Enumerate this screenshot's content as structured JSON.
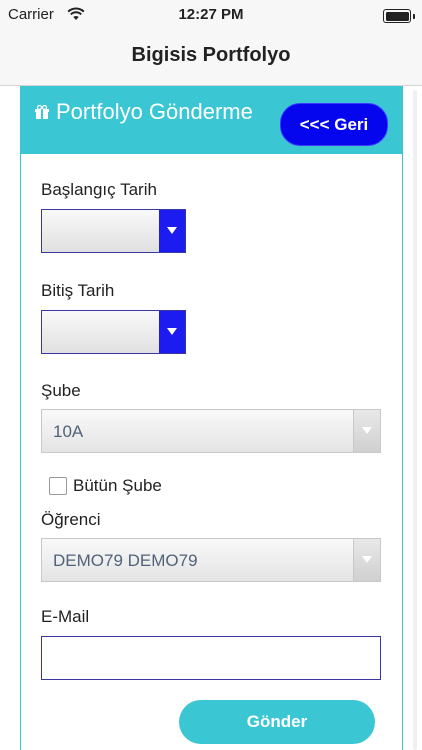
{
  "status_bar": {
    "carrier": "Carrier",
    "time": "12:27 PM"
  },
  "nav": {
    "title": "Bigisis Portfolyo"
  },
  "card": {
    "heading": "Portfolyo Gönderme",
    "back_label": "<<< Geri",
    "accent_color": "#3ac7d3",
    "button_color": "#0606ee"
  },
  "form": {
    "start_date_label": "Başlangıç Tarih",
    "start_date_value": "",
    "end_date_label": "Bitiş Tarih",
    "end_date_value": "",
    "branch_label": "Şube",
    "branch_value": "10A",
    "all_branches_label": "Bütün Şube",
    "all_branches_checked": false,
    "student_label": "Öğrenci",
    "student_value": "DEMO79 DEMO79",
    "email_label": "E-Mail",
    "email_value": "",
    "submit_label": "Gönder"
  },
  "icons": {
    "wifi": "wifi-icon",
    "battery": "battery-icon",
    "gift": "gift-icon"
  }
}
